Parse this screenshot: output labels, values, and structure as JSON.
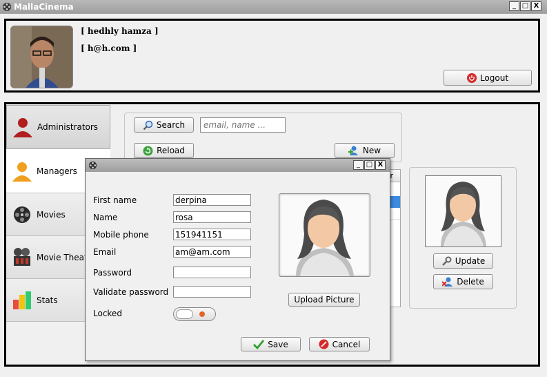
{
  "window": {
    "title": "MallaCinema",
    "controls": [
      "_",
      "□",
      "X"
    ]
  },
  "header": {
    "user_name": "[ hedhly hamza ]",
    "user_email": "[ h@h.com ]",
    "logout_label": "Logout"
  },
  "sidebar": {
    "items": [
      {
        "label": "Administrators",
        "icon": "user-red-icon"
      },
      {
        "label": "Managers",
        "icon": "user-orange-icon"
      },
      {
        "label": "Movies",
        "icon": "film-reel-icon"
      },
      {
        "label": "Movie Theate",
        "icon": "cinema-icon"
      },
      {
        "label": "Stats",
        "icon": "bar-chart-icon"
      }
    ]
  },
  "toolbar": {
    "search_label": "Search",
    "search_placeholder": "email, name ...",
    "reload_label": "Reload",
    "new_label": "New"
  },
  "right_panel": {
    "update_label": "Update",
    "delete_label": "Delete"
  },
  "table": {
    "partial_header": "r"
  },
  "dialog": {
    "controls": [
      "_",
      "□",
      "X"
    ],
    "fields": [
      {
        "label": "First name",
        "value": "derpina"
      },
      {
        "label": "Name",
        "value": "rosa"
      },
      {
        "label": "Mobile phone",
        "value": "151941151"
      },
      {
        "label": "Email",
        "value": "am@am.com"
      },
      {
        "label": "Password",
        "value": ""
      },
      {
        "label": "Validate password",
        "value": ""
      }
    ],
    "locked_label": "Locked",
    "locked": false,
    "upload_label": "Upload Picture",
    "save_label": "Save",
    "cancel_label": "Cancel"
  },
  "colors": {
    "accent_red": "#d42a2a",
    "toggle_dot": "#e0672a",
    "selected_row": "#3b8be0"
  }
}
